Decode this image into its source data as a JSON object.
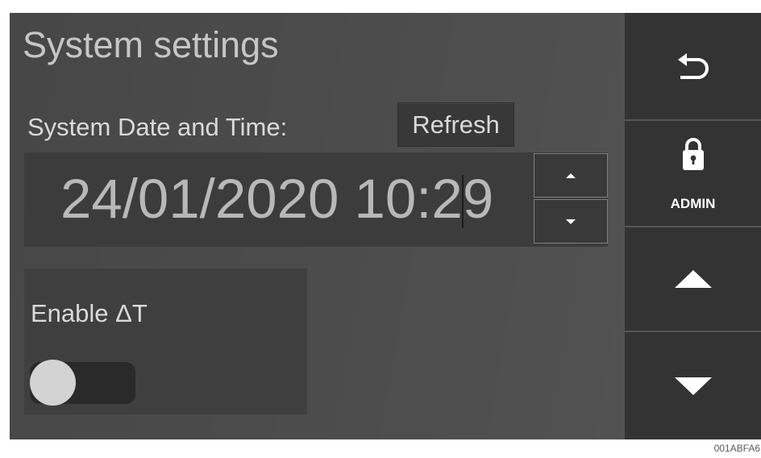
{
  "screen": {
    "title": "System settings"
  },
  "datetime": {
    "label": "System Date and Time:",
    "refresh_label": "Refresh",
    "value": "24/01/2020 10:29",
    "caret_index": 15,
    "increment_icon": "caret-up-icon",
    "decrement_icon": "caret-down-icon"
  },
  "delta_t": {
    "label": "Enable ΔT",
    "enabled": false
  },
  "sidebar": {
    "back_icon": "back-arrow-icon",
    "admin": {
      "icon": "lock-icon",
      "label": "ADMIN"
    },
    "scroll_up_icon": "triangle-up-icon",
    "scroll_down_icon": "triangle-down-icon"
  },
  "footer": {
    "label": "001ABFA6"
  },
  "colors": {
    "screen_bg": "#4b4b4b",
    "sidebar_bg": "#333333",
    "field_bg": "#3c3c3c",
    "card_bg": "#3f3f3f",
    "text": "#dadada",
    "value_text": "#b8b8b8",
    "icon": "#ffffff",
    "toggle_knob": "#d3d3d3",
    "toggle_track": "#2a2a2a"
  }
}
